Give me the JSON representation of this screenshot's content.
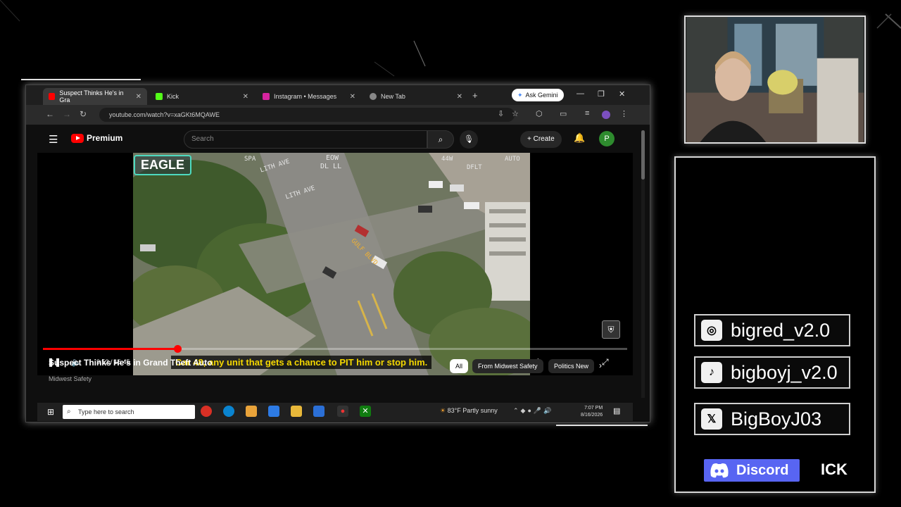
{
  "browser": {
    "tabs": [
      {
        "label": "Suspect Thinks He's in Gra",
        "active": true
      },
      {
        "label": "Kick",
        "active": false
      },
      {
        "label": "Instagram • Messages",
        "active": false
      },
      {
        "label": "New Tab",
        "active": false
      }
    ],
    "gemini_label": "Ask Gemini",
    "url": "youtube.com/watch?v=xaGKt6MQAWE"
  },
  "youtube": {
    "brand": "Premium",
    "search_placeholder": "Search",
    "create_label": "Create",
    "avatar_letter": "P",
    "video": {
      "badge": "EAGLE",
      "overlay": {
        "left": "SPA",
        "street1": "LITH AVE",
        "street2": "LITH AVE",
        "center_top": "EOW",
        "center_sub": "DL LL",
        "heading": "44W",
        "right_top": "AUTO",
        "right_sub": "DFLT",
        "road": "GULF BLVD"
      },
      "subtitle": "Car 48, any unit that gets a chance to PIT him or stop him.",
      "time": "3:52 / 16:45",
      "progress": 0.23
    },
    "title": "Suspect Thinks He's in Grand Theft Auto",
    "channel": "Midwest Safety",
    "chips": [
      "All",
      "From Midwest Safety",
      "Politics New"
    ]
  },
  "taskbar": {
    "search_placeholder": "Type here to search",
    "weather": "83°F  Partly sunny",
    "time": "7:07 PM",
    "date": "8/16/2026"
  },
  "socials": [
    {
      "icon": "instagram-icon",
      "handle": "bigred_v2.0"
    },
    {
      "icon": "tiktok-icon",
      "handle": "bigboyj_v2.0"
    },
    {
      "icon": "x-icon",
      "handle": "BigBoyJ03"
    }
  ],
  "discord_label": "Discord",
  "kick_label": "ICK",
  "colors": {
    "youtube_red": "#ff0000",
    "discord": "#5865f2",
    "subtitle": "#f5d800",
    "eagle_border": "#4ddac0"
  }
}
